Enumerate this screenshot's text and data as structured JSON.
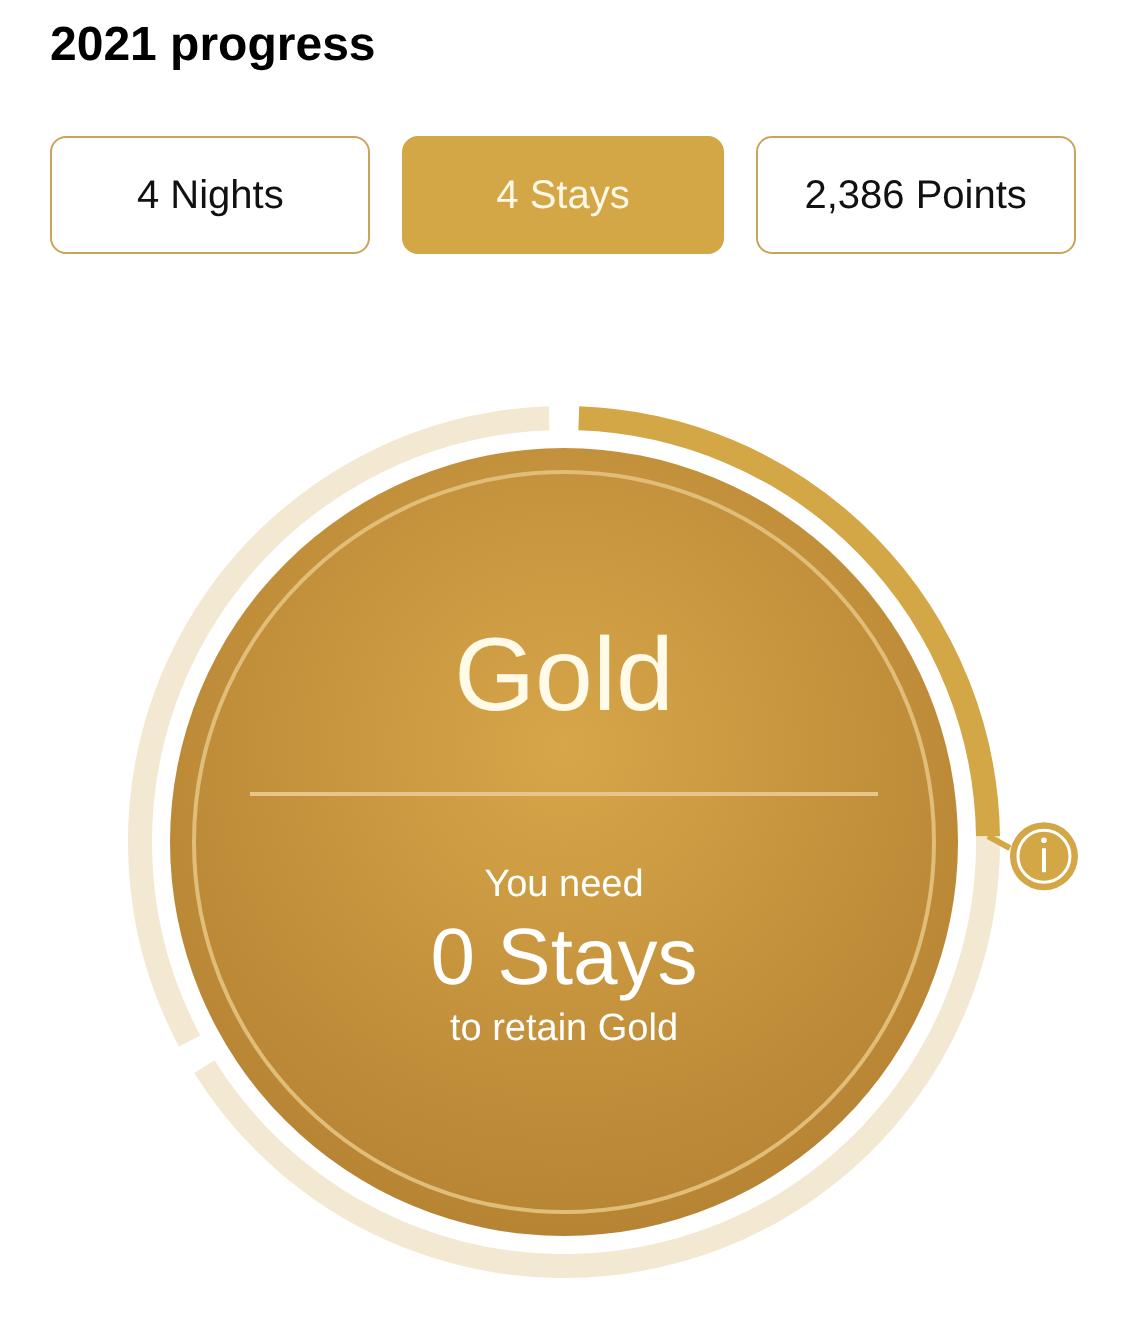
{
  "title": "2021 progress",
  "tabs": [
    {
      "label": "4 Nights",
      "selected": false
    },
    {
      "label": "4 Stays",
      "selected": true
    },
    {
      "label": "2,386 Points",
      "selected": false
    }
  ],
  "tier": {
    "name": "Gold",
    "need_label": "You need",
    "need_value": "0 Stays",
    "retain_label": "to retain Gold"
  }
}
